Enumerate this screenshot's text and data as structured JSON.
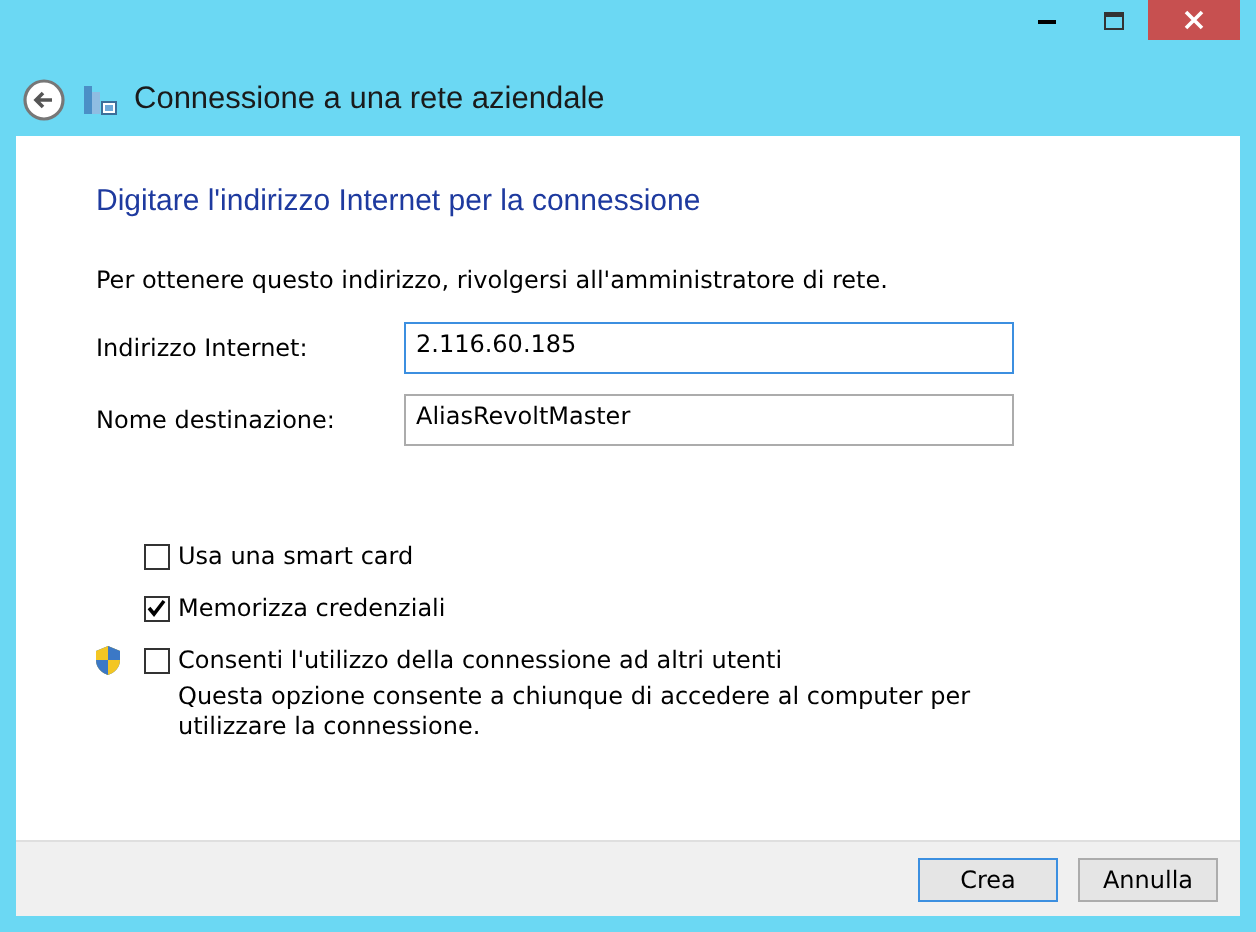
{
  "window": {
    "title": "Connessione a una rete aziendale"
  },
  "heading": "Digitare l'indirizzo Internet per la connessione",
  "instruction": "Per ottenere questo indirizzo, rivolgersi all'amministratore di rete.",
  "fields": [
    {
      "label": "Indirizzo Internet:",
      "value": "2.116.60.185",
      "focused": true
    },
    {
      "label": "Nome destinazione:",
      "value": "AliasRevoltMaster",
      "focused": false
    }
  ],
  "options": [
    {
      "kind": "plain",
      "label": "Usa una smart card",
      "checked": false
    },
    {
      "kind": "plain",
      "label": "Memorizza credenziali",
      "checked": true
    },
    {
      "kind": "shield",
      "label": "Consenti l'utilizzo della connessione ad altri utenti",
      "checked": false,
      "description": "Questa opzione consente a chiunque di accedere al computer per utilizzare la connessione."
    }
  ],
  "buttons": [
    {
      "label": "Crea",
      "default": true
    },
    {
      "label": "Annulla",
      "default": false
    }
  ]
}
